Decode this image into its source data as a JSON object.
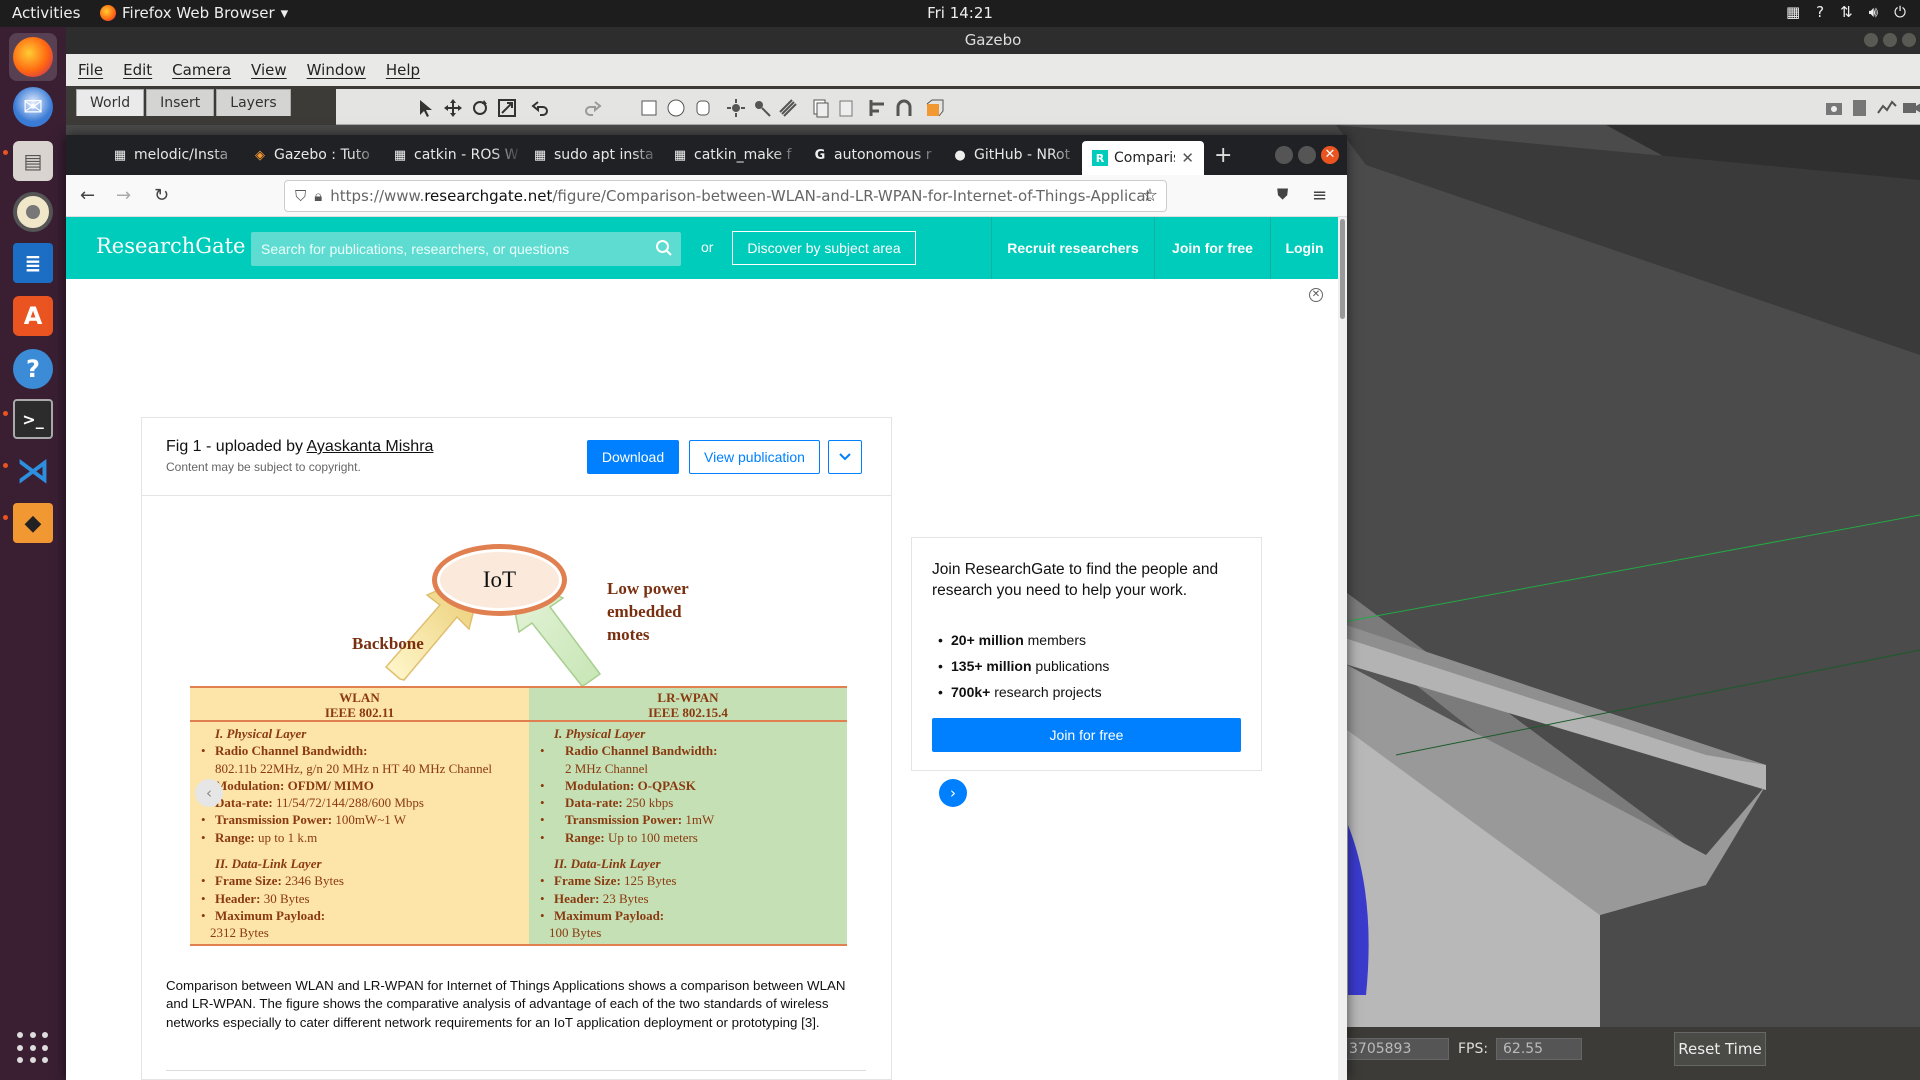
{
  "os": {
    "activities": "Activities",
    "app_menu": "Firefox Web Browser",
    "clock": "Fri 14:21"
  },
  "gazebo": {
    "title": "Gazebo",
    "menu": [
      "File",
      "Edit",
      "Camera",
      "View",
      "Window",
      "Help"
    ],
    "left_tabs": [
      "World",
      "Insert",
      "Layers"
    ],
    "status": {
      "real_time_value": "3705893",
      "fps_label": "FPS:",
      "fps_value": "62.55",
      "reset_label": "Reset Time"
    }
  },
  "firefox": {
    "tabs": [
      {
        "label": "melodic/Insta",
        "icon": "ros-grid-icon"
      },
      {
        "label": "Gazebo : Tuto",
        "icon": "gazebo-icon"
      },
      {
        "label": "catkin - ROS W",
        "icon": "ros-grid-icon"
      },
      {
        "label": "sudo apt insta",
        "icon": "ros-grid-icon"
      },
      {
        "label": "catkin_make f",
        "icon": "ros-grid-icon"
      },
      {
        "label": "autonomous r",
        "icon": "google-icon"
      },
      {
        "label": "GitHub - NRot",
        "icon": "github-icon"
      },
      {
        "label": "Comparison",
        "icon": "researchgate-icon",
        "active": true
      }
    ],
    "url_prefix": "https://www.",
    "url_domain": "researchgate.net",
    "url_path": "/figure/Comparison-between-WLAN-and-LR-WPAN-for-Internet-of-Things-Applicat"
  },
  "rg": {
    "logo": "ResearchGate",
    "search_placeholder": "Search for publications, researchers, or questions",
    "or": "or",
    "discover": "Discover by subject area",
    "recruit": "Recruit researchers",
    "join": "Join for free",
    "login": "Login",
    "figure": {
      "title_prefix": "Fig 1 - uploaded by ",
      "author": "Ayaskanta Mishra",
      "note": "Content may be subject to copyright.",
      "download": "Download",
      "view_publication": "View publication",
      "description": "Comparison between WLAN and LR-WPAN for Internet of Things Applications shows a comparison between WLAN and LR-WPAN. The figure shows the comparative analysis of advantage of each of the two standards of wireless networks especially to cater different network requirements for an IoT application deployment or prototyping [3]."
    },
    "diagram": {
      "center": "IoT",
      "left_label": "Backbone",
      "right_label_1": "Low power",
      "right_label_2": "embedded",
      "right_label_3": "motes",
      "wlan": {
        "head1": "WLAN",
        "head2": "IEEE 802.11",
        "sec1": "I. Physical Layer",
        "bw_label": "Radio Channel Bandwidth:",
        "bw_value": "802.11b 22MHz, g/n 20 MHz n HT 40 MHz Channel",
        "mod_label": "Modulation: OFDM/ MIMO",
        "rate_label": "Data-rate:",
        "rate_value": " 11/54/72/144/288/600 Mbps",
        "power_label": "Transmission Power:",
        "power_value": " 100mW~1 W",
        "range_label": "Range:",
        "range_value": " up to 1 k.m",
        "sec2": "II. Data-Link Layer",
        "frame_label": "Frame Size:",
        "frame_value": " 2346 Bytes",
        "header_label": "Header:",
        "header_value": " 30 Bytes",
        "payload_label": "Maximum Payload:",
        "payload_value": "2312 Bytes"
      },
      "lrwpan": {
        "head1": "LR-WPAN",
        "head2": "IEEE 802.15.4",
        "sec1": "I. Physical Layer",
        "bw_label": "Radio Channel Bandwidth:",
        "bw_value": "2 MHz Channel",
        "mod_label": "Modulation: O-QPASK",
        "rate_label": "Data-rate:",
        "rate_value": " 250 kbps",
        "power_label": "Transmission Power:",
        "power_value": " 1mW",
        "range_label": "Range:",
        "range_value": " Up to 100 meters",
        "sec2": "II. Data-Link Layer",
        "frame_label": "Frame Size:",
        "frame_value": " 125 Bytes",
        "header_label": "Header:",
        "header_value": " 23 Bytes",
        "payload_label": "Maximum Payload:",
        "payload_value": "100 Bytes"
      }
    },
    "join_box": {
      "text": "Join ResearchGate to find the people and research you need to help your work.",
      "stats": [
        {
          "bold": "20+ million",
          "rest": " members"
        },
        {
          "bold": "135+ million",
          "rest": " publications"
        },
        {
          "bold": "700k+",
          "rest": " research projects"
        }
      ],
      "button": "Join for free"
    }
  },
  "colors": {
    "rg_teal": "#00ccbb",
    "rg_blue": "#0080ff",
    "ubuntu_orange": "#e95420",
    "dock_bg": "#3a1f33"
  }
}
